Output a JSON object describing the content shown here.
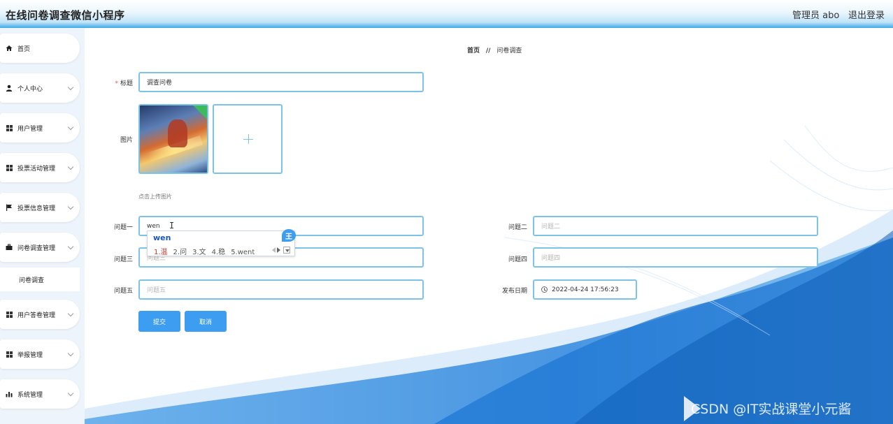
{
  "header": {
    "app_title": "在线问卷调查微信小程序",
    "admin_label": "管理员 abo",
    "logout_label": "退出登录"
  },
  "sidebar": {
    "items": [
      {
        "label": "首页",
        "icon": "home-icon"
      },
      {
        "label": "个人中心",
        "icon": "user-icon"
      },
      {
        "label": "用户管理",
        "icon": "grid-icon"
      },
      {
        "label": "投票活动管理",
        "icon": "grid-icon"
      },
      {
        "label": "投票信息管理",
        "icon": "flag-icon"
      },
      {
        "label": "问卷调查管理",
        "icon": "briefcase-icon"
      },
      {
        "label": "用户答卷管理",
        "icon": "grid-icon"
      },
      {
        "label": "举报管理",
        "icon": "grid-icon"
      },
      {
        "label": "系统管理",
        "icon": "bar-chart-icon"
      }
    ],
    "sub_item": "问卷调查"
  },
  "breadcrumb": {
    "home": "首页",
    "separator": "//",
    "current": "问卷调查"
  },
  "form": {
    "title_label": "标题",
    "title_value": "调查问卷",
    "image_label": "图片",
    "upload_hint": "点击上传图片",
    "q1_label": "问题一",
    "q1_value": "wen",
    "q2_label": "问题二",
    "q2_placeholder": "问题二",
    "q3_label": "问题三",
    "q3_placeholder": "问题三",
    "q4_label": "问题四",
    "q4_placeholder": "问题四",
    "q5_label": "问题五",
    "q5_placeholder": "问题五",
    "date_label": "发布日期",
    "date_value": "2022-04-24 17:56:23",
    "submit_label": "提交",
    "cancel_label": "取消"
  },
  "ime": {
    "composition": "wen",
    "candidates": [
      "1.温",
      "2.问",
      "3.文",
      "4.稳",
      "5.went"
    ],
    "badge": "王"
  },
  "watermark": "CSDN @IT实战课堂小元酱",
  "colors": {
    "accent": "#3d9df0",
    "input_border": "#7cc3e8",
    "required": "#e95a5a"
  }
}
